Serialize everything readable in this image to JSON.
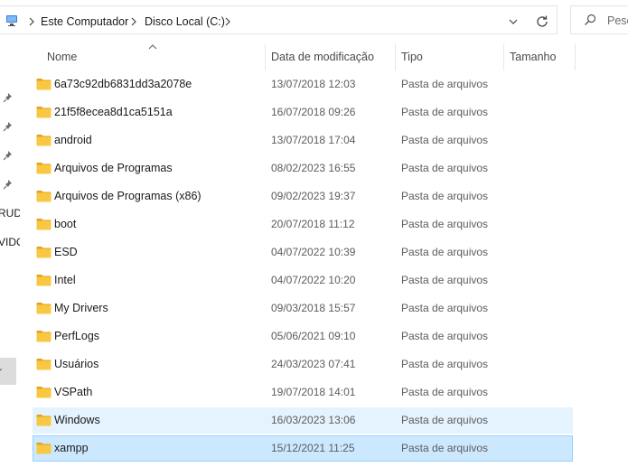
{
  "address_bar": {
    "breadcrumb": [
      "Este Computador",
      "Disco Local (C:)"
    ]
  },
  "search": {
    "placeholder": "Pesc"
  },
  "nav_pane": {
    "partial_labels": [
      "RUD",
      "VIDO",
      "r"
    ]
  },
  "columns": {
    "name": "Nome",
    "date": "Data de modificação",
    "type": "Tipo",
    "size": "Tamanho"
  },
  "rows": [
    {
      "name": "6a73c92db6831dd3a2078e",
      "date": "13/07/2018 12:03",
      "type": "Pasta de arquivos",
      "state": "normal"
    },
    {
      "name": "21f5f8ecea8d1ca5151a",
      "date": "16/07/2018 09:26",
      "type": "Pasta de arquivos",
      "state": "normal"
    },
    {
      "name": "android",
      "date": "13/07/2018 17:04",
      "type": "Pasta de arquivos",
      "state": "normal"
    },
    {
      "name": "Arquivos de Programas",
      "date": "08/02/2023 16:55",
      "type": "Pasta de arquivos",
      "state": "normal"
    },
    {
      "name": "Arquivos de Programas (x86)",
      "date": "09/02/2023 19:37",
      "type": "Pasta de arquivos",
      "state": "normal"
    },
    {
      "name": "boot",
      "date": "20/07/2018 11:12",
      "type": "Pasta de arquivos",
      "state": "normal"
    },
    {
      "name": "ESD",
      "date": "04/07/2022 10:39",
      "type": "Pasta de arquivos",
      "state": "normal"
    },
    {
      "name": "Intel",
      "date": "04/07/2022 10:20",
      "type": "Pasta de arquivos",
      "state": "normal"
    },
    {
      "name": "My Drivers",
      "date": "09/03/2018 15:57",
      "type": "Pasta de arquivos",
      "state": "normal"
    },
    {
      "name": "PerfLogs",
      "date": "05/06/2021 09:10",
      "type": "Pasta de arquivos",
      "state": "normal"
    },
    {
      "name": "Usuários",
      "date": "24/03/2023 07:41",
      "type": "Pasta de arquivos",
      "state": "normal"
    },
    {
      "name": "VSPath",
      "date": "19/07/2018 14:01",
      "type": "Pasta de arquivos",
      "state": "normal"
    },
    {
      "name": "Windows",
      "date": "16/03/2023 13:06",
      "type": "Pasta de arquivos",
      "state": "hover"
    },
    {
      "name": "xampp",
      "date": "15/12/2021 11:25",
      "type": "Pasta de arquivos",
      "state": "selected"
    }
  ],
  "colors": {
    "hover_row": "#e5f3ff",
    "selected_row": "#cce8ff",
    "selected_border": "#99d1ff",
    "folder_yellow": "#f8c843"
  },
  "icons": {
    "computer": "computer-icon",
    "chevron": "chevron-right-icon",
    "dropdown": "chevron-down-icon",
    "refresh": "refresh-icon",
    "search": "search-icon",
    "pin": "pin-icon",
    "folder": "folder-icon",
    "sort": "sort-ascending-icon"
  }
}
